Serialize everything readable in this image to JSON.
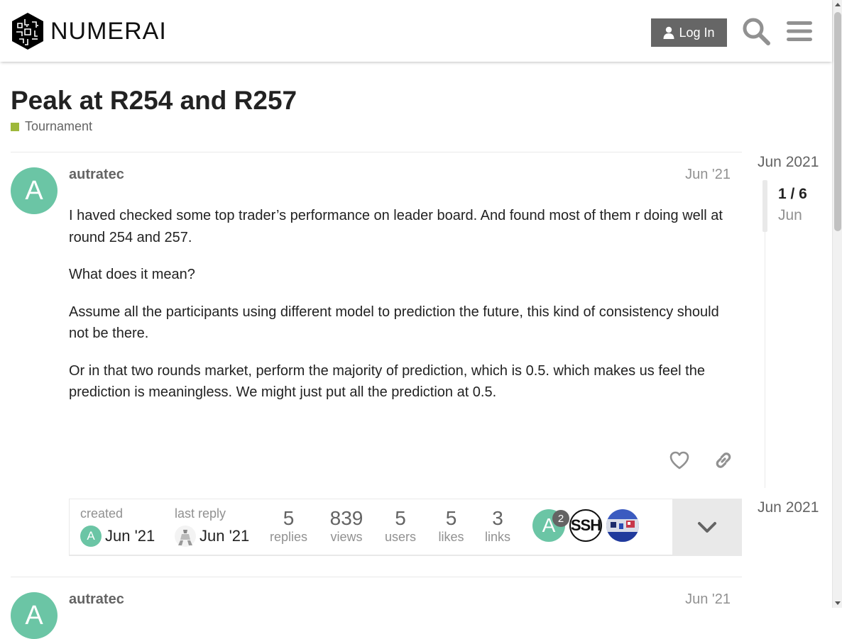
{
  "header": {
    "logo_text": "NUMERAI",
    "login_label": "Log In",
    "search_icon": "search-icon",
    "menu_icon": "hamburger-icon"
  },
  "topic": {
    "title": "Peak at R254 and R257",
    "category": "Tournament",
    "category_color": "#9eb83b"
  },
  "posts": [
    {
      "avatar_letter": "A",
      "avatar_color": "#6bc5a5",
      "username": "autratec",
      "date": "Jun '21",
      "paragraphs": [
        "I haved checked some top trader’s performance on leader board. And found most of them r doing well at round 254 and 257.",
        "What does it mean?",
        "Assume all the participants using different model to prediction the future, this kind of consistency should not be there.",
        "Or in that two rounds market, perform the majority of prediction, which is 0.5. which makes us feel the prediction is meaningless. We might just put all the prediction at 0.5."
      ]
    },
    {
      "avatar_letter": "A",
      "username": "autratec",
      "date": "Jun '21"
    }
  ],
  "topic_map": {
    "created_label": "created",
    "created_avatar": "A",
    "created_date": "Jun '21",
    "last_reply_label": "last reply",
    "last_reply_date": "Jun '21",
    "stats": [
      {
        "num": "5",
        "label": "replies"
      },
      {
        "num": "839",
        "label": "views"
      },
      {
        "num": "5",
        "label": "users"
      },
      {
        "num": "5",
        "label": "likes"
      },
      {
        "num": "3",
        "label": "links"
      }
    ],
    "participants": [
      {
        "letter": "A",
        "count": "2"
      },
      {
        "letter": "SSH"
      },
      {
        "letter": ""
      }
    ]
  },
  "timeline": {
    "top_date": "Jun 2021",
    "position": "1 / 6",
    "position_date": "Jun",
    "bottom_date": "Jun 2021"
  }
}
